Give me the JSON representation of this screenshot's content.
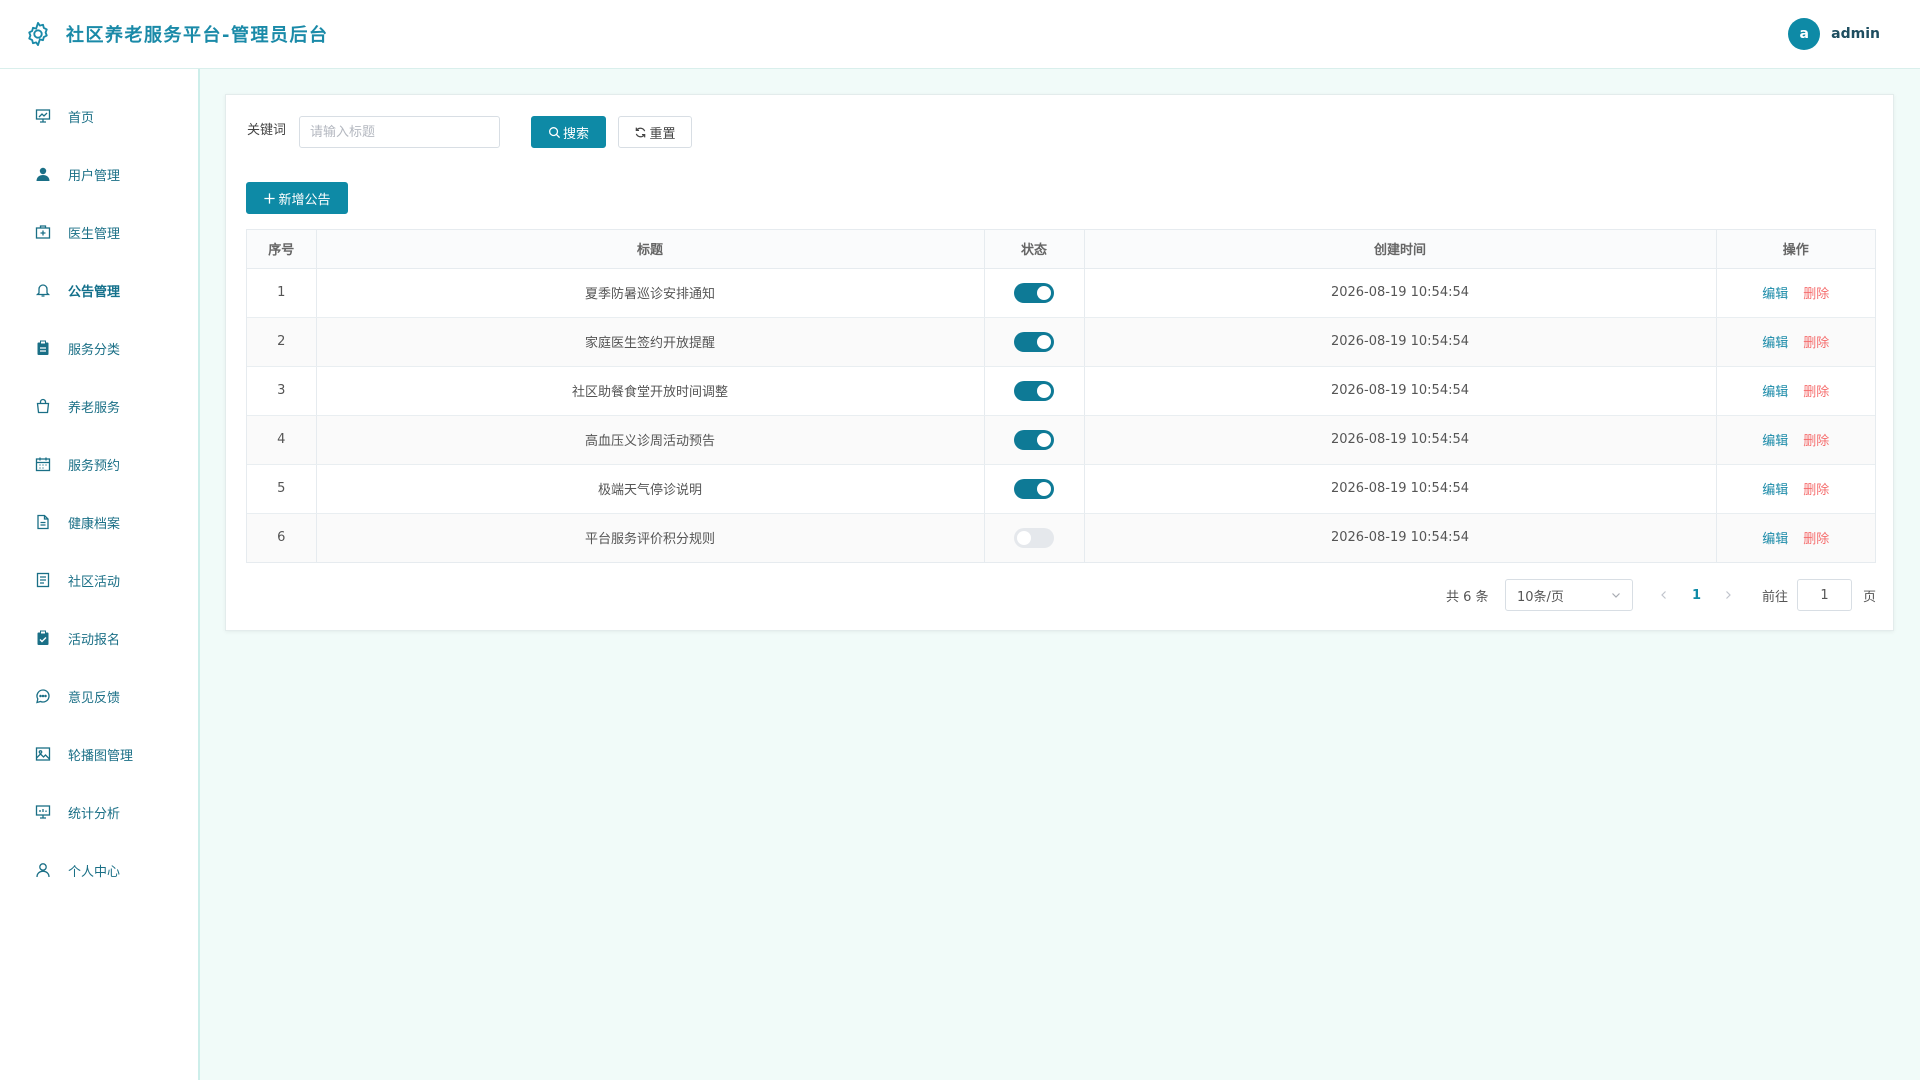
{
  "header": {
    "title": "社区养老服务平台-管理员后台",
    "avatar_letter": "a",
    "username": "admin"
  },
  "sidebar": {
    "items": [
      {
        "label": "首页",
        "icon": "dashboard-icon"
      },
      {
        "label": "用户管理",
        "icon": "user-icon"
      },
      {
        "label": "医生管理",
        "icon": "medical-kit-icon"
      },
      {
        "label": "公告管理",
        "icon": "bell-icon"
      },
      {
        "label": "服务分类",
        "icon": "clipboard-icon"
      },
      {
        "label": "养老服务",
        "icon": "shopping-bag-icon"
      },
      {
        "label": "服务预约",
        "icon": "calendar-icon"
      },
      {
        "label": "健康档案",
        "icon": "document-icon"
      },
      {
        "label": "社区活动",
        "icon": "list-document-icon"
      },
      {
        "label": "活动报名",
        "icon": "checked-clipboard-icon"
      },
      {
        "label": "意见反馈",
        "icon": "chat-icon"
      },
      {
        "label": "轮播图管理",
        "icon": "picture-icon"
      },
      {
        "label": "统计分析",
        "icon": "chart-board-icon"
      },
      {
        "label": "个人中心",
        "icon": "person-outline-icon"
      }
    ],
    "active_index": 3
  },
  "filter": {
    "keyword_label": "关键词",
    "keyword_placeholder": "请输入标题",
    "keyword_value": "",
    "search_label": "搜索",
    "reset_label": "重置",
    "add_label": "新增公告"
  },
  "table": {
    "columns": [
      "序号",
      "标题",
      "状态",
      "创建时间",
      "操作"
    ],
    "rows": [
      {
        "index": "1",
        "title": "夏季防暑巡诊安排通知",
        "status_on": true,
        "created": "2026-08-19 10:54:54"
      },
      {
        "index": "2",
        "title": "家庭医生签约开放提醒",
        "status_on": true,
        "created": "2026-08-19 10:54:54"
      },
      {
        "index": "3",
        "title": "社区助餐食堂开放时间调整",
        "status_on": true,
        "created": "2026-08-19 10:54:54"
      },
      {
        "index": "4",
        "title": "高血压义诊周活动预告",
        "status_on": true,
        "created": "2026-08-19 10:54:54"
      },
      {
        "index": "5",
        "title": "极端天气停诊说明",
        "status_on": true,
        "created": "2026-08-19 10:54:54"
      },
      {
        "index": "6",
        "title": "平台服务评价积分规则",
        "status_on": false,
        "created": "2026-08-19 10:54:54"
      }
    ],
    "edit_label": "编辑",
    "delete_label": "删除"
  },
  "pagination": {
    "total": "共 6 条",
    "page_size": "10条/页",
    "current_page": "1",
    "goto_label": "前往",
    "goto_value": "1",
    "page_unit": "页"
  },
  "colors": {
    "primary": "#0e8aa6",
    "danger": "#f56c6c",
    "background": "#f1fbf9"
  }
}
